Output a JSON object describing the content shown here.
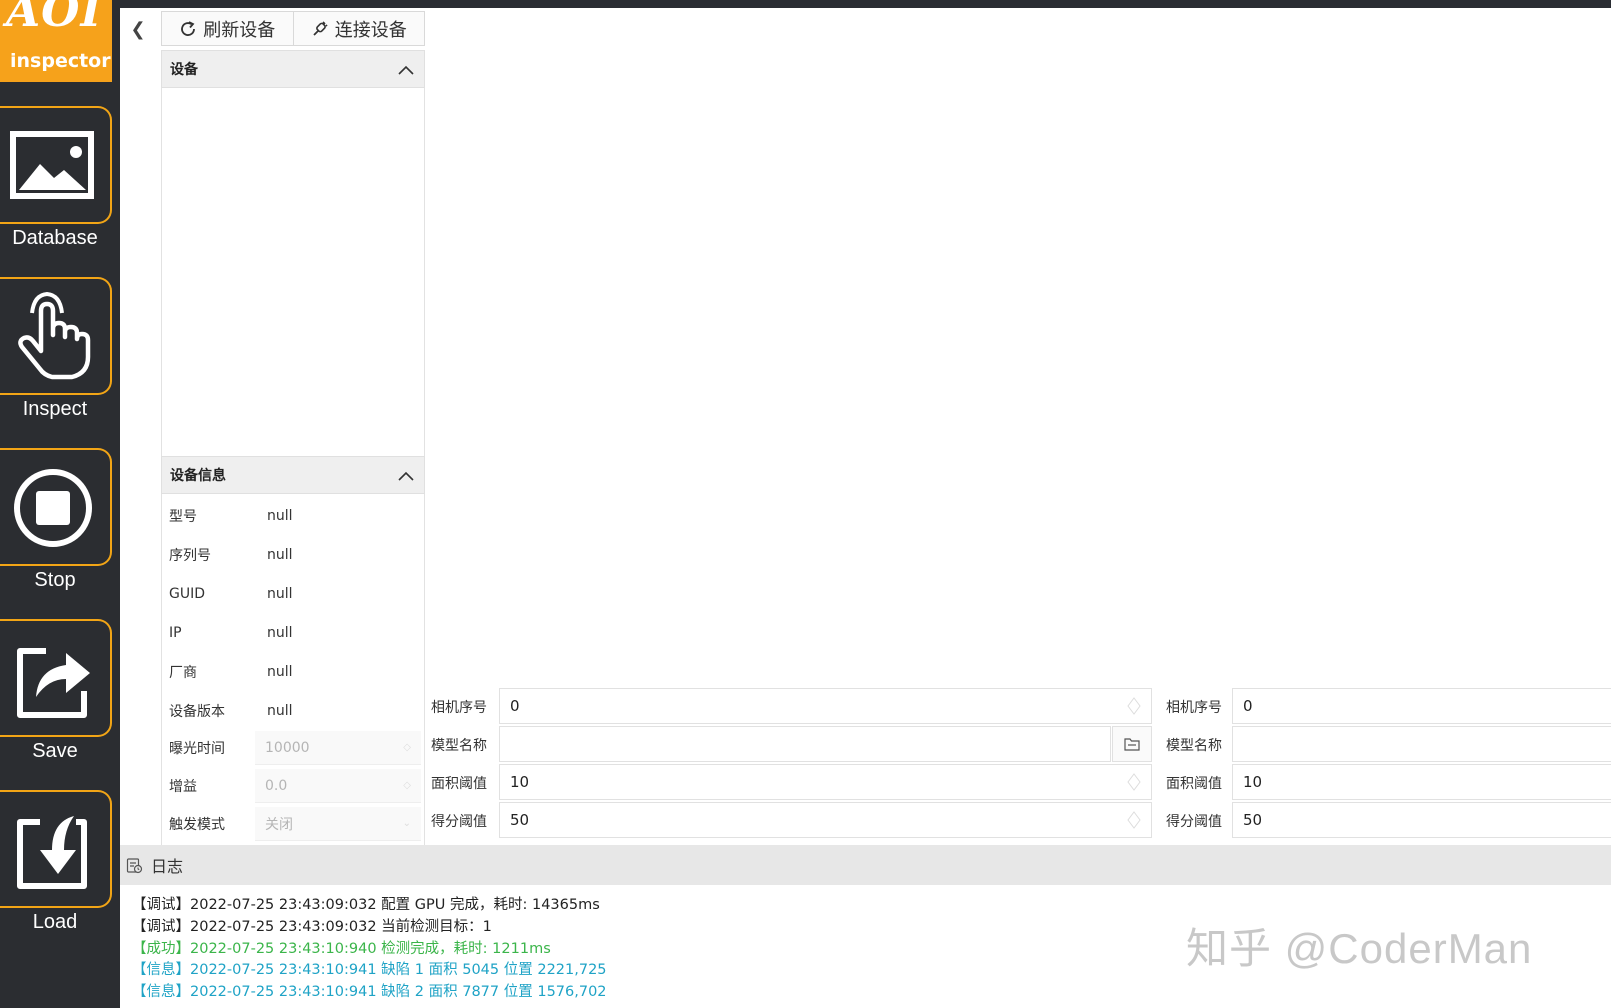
{
  "nav": {
    "logo_big": "AOI",
    "logo_small": "inspector",
    "items": [
      {
        "label": "Database",
        "icon": "image-icon"
      },
      {
        "label": "Inspect",
        "icon": "hand-pointer-icon"
      },
      {
        "label": "Stop",
        "icon": "stop-icon"
      },
      {
        "label": "Save",
        "icon": "share-export-icon"
      },
      {
        "label": "Load",
        "icon": "import-icon"
      }
    ]
  },
  "toolbar": {
    "refresh_label": "刷新设备",
    "connect_label": "连接设备"
  },
  "devices": {
    "title": "设备"
  },
  "device_info": {
    "title": "设备信息",
    "rows": [
      {
        "key": "型号",
        "value": "null"
      },
      {
        "key": "序列号",
        "value": "null"
      },
      {
        "key": "GUID",
        "value": "null"
      },
      {
        "key": "IP",
        "value": "null"
      },
      {
        "key": "厂商",
        "value": "null"
      },
      {
        "key": "设备版本",
        "value": "null"
      }
    ],
    "exposure": {
      "key": "曝光时间",
      "value": "10000"
    },
    "gain": {
      "key": "增益",
      "value": "0.0"
    },
    "trigger": {
      "key": "触发模式",
      "value": "关闭"
    }
  },
  "params_left": {
    "camera_index_label": "相机序号",
    "camera_index": "0",
    "model_name_label": "模型名称",
    "model_name": "",
    "area_threshold_label": "面积阈值",
    "area_threshold": "10",
    "score_threshold_label": "得分阈值",
    "score_threshold": "50"
  },
  "params_right": {
    "camera_index_label": "相机序号",
    "camera_index": "0",
    "model_name_label": "模型名称",
    "model_name": "",
    "area_threshold_label": "面积阈值",
    "area_threshold": "10",
    "score_threshold_label": "得分阈值",
    "score_threshold": "50"
  },
  "log": {
    "title": "日志",
    "lines": [
      {
        "text": "【调试】2022-07-25 23:43:09:032 配置 GPU 完成，耗时: 14365ms",
        "color": "#222222"
      },
      {
        "text": "【调试】2022-07-25 23:43:09:032 当前检测目标：1",
        "color": "#222222"
      },
      {
        "text": "【成功】2022-07-25 23:43:10:940 检测完成，耗时: 1211ms",
        "color": "#3bb54a"
      },
      {
        "text": "【信息】2022-07-25 23:43:10:941 缺陷 1 面积 5045 位置 2221,725",
        "color": "#1fa3c6"
      },
      {
        "text": "【信息】2022-07-25 23:43:10:941 缺陷 2 面积 7877 位置 1576,702",
        "color": "#1fa3c6"
      }
    ]
  },
  "watermark": "知乎 @CoderMan",
  "colors": {
    "accent": "#f2a516",
    "sidebar": "#2b2d31"
  }
}
